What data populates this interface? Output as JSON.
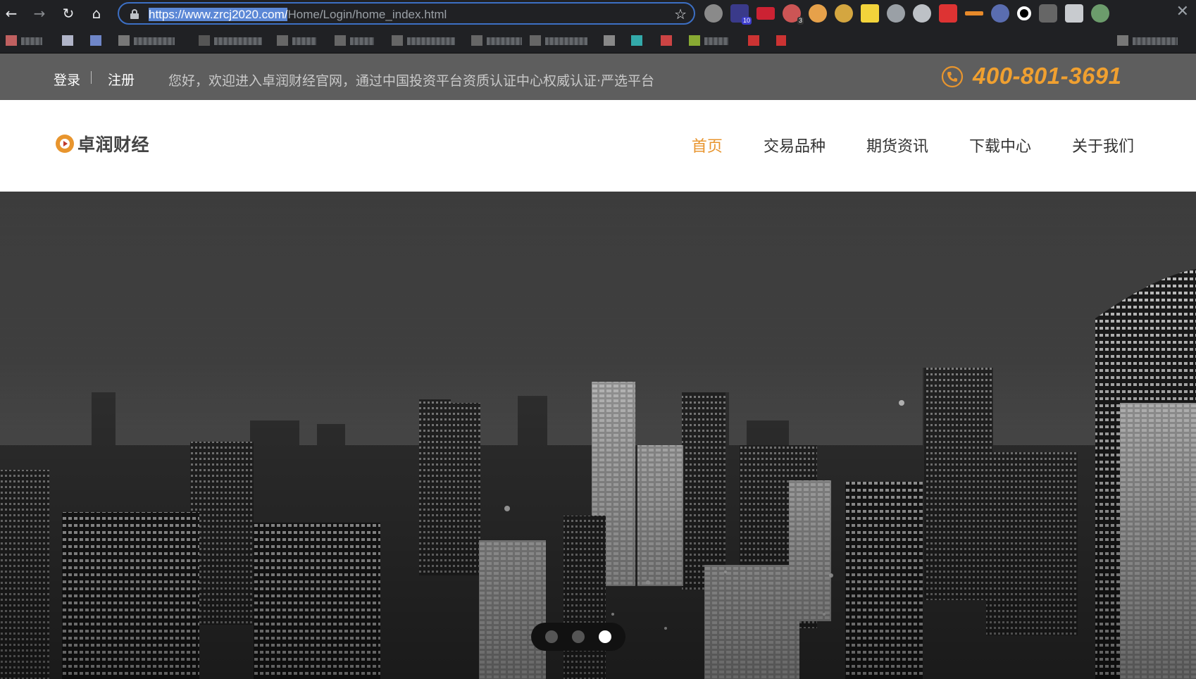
{
  "browser": {
    "url_highlighted": "https://www.zrcj2020.com/",
    "url_rest": "Home/Login/home_index.html",
    "extension_badges": [
      "10",
      "3"
    ],
    "icons": [
      "back-icon",
      "forward-icon",
      "reload-icon",
      "home-icon",
      "lock-icon",
      "star-icon",
      "puzzle-icon",
      "close-icon"
    ]
  },
  "topbar": {
    "login": "登录",
    "register": "注册",
    "welcome": "您好，欢迎进入卓润财经官网，通过中国投资平台资质认证中心权威认证·严选平台",
    "phone": "400-801-3691"
  },
  "header": {
    "logo_text": "卓润财经",
    "nav": [
      "首页",
      "交易品种",
      "期货资讯",
      "下载中心",
      "关于我们"
    ],
    "active_nav": "首页"
  },
  "hero": {
    "slide_count": 3,
    "active_slide": 3
  },
  "colors": {
    "accent": "#e8952e",
    "topbar_bg": "#5e5e5e",
    "browser_bg": "#202124"
  }
}
